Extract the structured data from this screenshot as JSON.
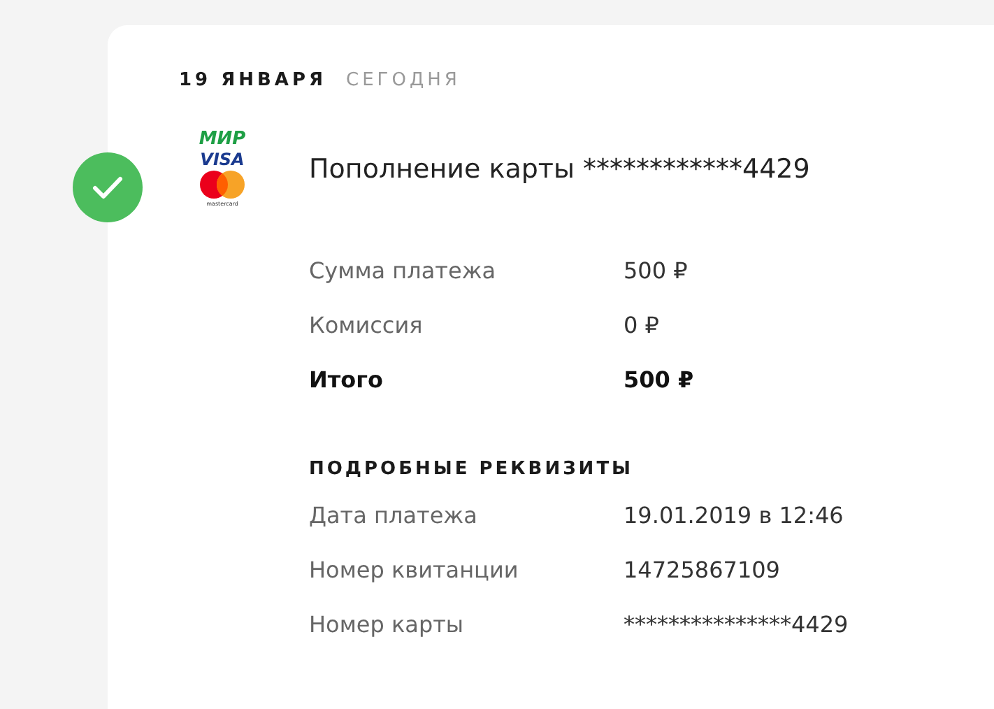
{
  "header": {
    "date": "19 ЯНВАРЯ",
    "relative": "СЕГОДНЯ"
  },
  "operation": {
    "success": true,
    "logos": [
      {
        "kind": "mir",
        "text": "МИР"
      },
      {
        "kind": "visa",
        "text": "VISA"
      },
      {
        "kind": "mastercard",
        "text": "mastercard"
      }
    ],
    "title": "Пополнение карты ************4429"
  },
  "summary": [
    {
      "label": "Сумма платежа",
      "value": "500 ₽",
      "kind": "normal"
    },
    {
      "label": "Комиссия",
      "value": "0 ₽",
      "kind": "normal"
    },
    {
      "label": "Итого",
      "value": "500 ₽",
      "kind": "total"
    }
  ],
  "details": {
    "title": "ПОДРОБНЫЕ РЕКВИЗИТЫ",
    "rows": [
      {
        "label": "Дата платежа",
        "value": "19.01.2019 в 12:46"
      },
      {
        "label": "Номер квитанции",
        "value": "14725867109"
      },
      {
        "label": "Номер карты",
        "value": "***************4429"
      }
    ]
  }
}
